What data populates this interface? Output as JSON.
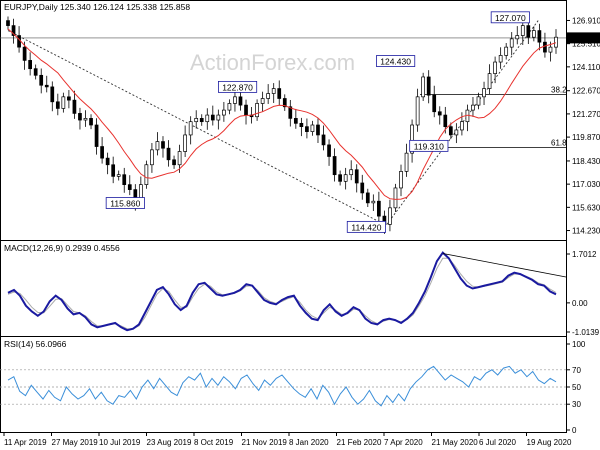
{
  "price_panel": {
    "header": "EURJPY,Daily  125.340 126.124 125.338 125.858",
    "watermark": "ActionForex.com",
    "y_ticks": [
      "126.910",
      "125.510",
      "124.110",
      "122.670",
      "121.270",
      "119.870",
      "118.430",
      "117.030",
      "115.630",
      "114.230"
    ],
    "current_price": "125.858",
    "price_labels": {
      "p127070": "127.070",
      "p124430": "124.430",
      "p122870": "122.870",
      "p115860": "115.860",
      "p119310": "119.310",
      "p114420": "114.420"
    },
    "fib_382": "38.2",
    "fib_618": "61.8"
  },
  "macd_panel": {
    "header": "MACD(12,26,9) 0.2939 0.4556",
    "y_ticks": [
      "1.7012",
      "0.00",
      "-1.0139"
    ]
  },
  "rsi_panel": {
    "header": "RSI(14) 56.0966",
    "y_ticks": [
      "100",
      "70",
      "50",
      "30",
      "0"
    ]
  },
  "x_axis": {
    "labels": [
      "11 Apr 2019",
      "27 May 2019",
      "10 Jul 2019",
      "23 Aug 2019",
      "8 Oct 2019",
      "21 Nov 2019",
      "8 Jan 2020",
      "21 Feb 2020",
      "7 Apr 2020",
      "21 May 2020",
      "6 Jul 2020",
      "19 Aug 2020"
    ]
  },
  "colors": {
    "candles": "#000000",
    "ma": "#e8322e",
    "macd": "#1a1aa0",
    "signal": "#aaaaaa",
    "rsi": "#3b8fd9",
    "label_box": "#1a1aa0",
    "current_price_bg": "#000000"
  },
  "chart_data": [
    {
      "type": "candlestick",
      "title": "EURJPY,Daily",
      "ohlc_last": {
        "open": 125.34,
        "high": 126.124,
        "low": 125.338,
        "close": 125.858
      },
      "ylim": [
        113.9,
        127.3
      ],
      "labeled_pivots": [
        {
          "label": "127.070",
          "value": 127.07
        },
        {
          "label": "124.430",
          "value": 124.43
        },
        {
          "label": "122.870",
          "value": 122.87
        },
        {
          "label": "119.310",
          "value": 119.31
        },
        {
          "label": "115.860",
          "value": 115.86
        },
        {
          "label": "114.420",
          "value": 114.42
        }
      ],
      "levels": [
        {
          "name": "38.2",
          "value": 122.45
        },
        {
          "name": "61.8",
          "value": 119.25
        }
      ],
      "closes": [
        126.6,
        126.0,
        125.3,
        124.5,
        124.0,
        123.6,
        123.0,
        122.9,
        122.0,
        121.6,
        122.3,
        122.1,
        121.3,
        120.9,
        121.0,
        120.6,
        119.3,
        118.6,
        118.2,
        117.5,
        117.6,
        117.0,
        116.7,
        116.0,
        117.0,
        118.2,
        119.1,
        119.6,
        119.2,
        118.5,
        118.2,
        119.0,
        120.0,
        120.8,
        121.0,
        120.8,
        121.2,
        120.9,
        121.2,
        121.5,
        121.9,
        122.3,
        121.8,
        121.2,
        121.1,
        121.9,
        122.2,
        122.5,
        122.8,
        122.2,
        121.7,
        121.0,
        120.7,
        120.5,
        120.2,
        120.6,
        120.0,
        119.4,
        118.7,
        117.6,
        117.2,
        117.6,
        117.9,
        117.1,
        116.5,
        115.9,
        116.0,
        115.1,
        114.6,
        115.6,
        116.8,
        117.8,
        118.9,
        120.6,
        122.3,
        123.5,
        122.4,
        121.4,
        121.2,
        120.5,
        120.0,
        120.3,
        120.8,
        121.5,
        121.8,
        122.3,
        122.8,
        123.7,
        124.4,
        124.8,
        125.3,
        125.8,
        126.0,
        126.6,
        125.9,
        126.3,
        125.6,
        125.0,
        125.3,
        125.9
      ]
    },
    {
      "type": "line",
      "title": "MACD(12,26,9)",
      "series": [
        {
          "name": "MACD",
          "value": 0.2939
        },
        {
          "name": "Signal",
          "value": 0.4556
        }
      ],
      "ylim": [
        -1.0139,
        1.7012
      ],
      "macd": [
        0.35,
        0.45,
        0.25,
        -0.1,
        -0.3,
        -0.45,
        -0.3,
        0.05,
        0.25,
        0.1,
        -0.2,
        -0.4,
        -0.35,
        -0.5,
        -0.75,
        -0.85,
        -0.8,
        -0.75,
        -0.7,
        -0.85,
        -0.95,
        -0.9,
        -0.75,
        -0.35,
        0.05,
        0.45,
        0.55,
        0.3,
        -0.05,
        -0.25,
        -0.1,
        0.35,
        0.65,
        0.7,
        0.5,
        0.3,
        0.25,
        0.3,
        0.35,
        0.45,
        0.65,
        0.6,
        0.35,
        0.1,
        0.0,
        -0.05,
        0.1,
        0.2,
        0.25,
        -0.1,
        -0.35,
        -0.55,
        -0.6,
        -0.25,
        -0.05,
        -0.3,
        -0.45,
        -0.35,
        -0.15,
        -0.25,
        -0.55,
        -0.7,
        -0.75,
        -0.6,
        -0.55,
        -0.6,
        -0.7,
        -0.55,
        -0.35,
        0.0,
        0.4,
        0.9,
        1.45,
        1.75,
        1.55,
        1.2,
        0.85,
        0.6,
        0.5,
        0.55,
        0.6,
        0.65,
        0.7,
        0.75,
        0.95,
        1.05,
        1.0,
        0.9,
        0.8,
        0.65,
        0.6,
        0.4,
        0.3
      ],
      "signal": [
        0.3,
        0.38,
        0.33,
        0.1,
        -0.15,
        -0.33,
        -0.35,
        -0.12,
        0.12,
        0.15,
        -0.08,
        -0.3,
        -0.35,
        -0.45,
        -0.65,
        -0.8,
        -0.8,
        -0.76,
        -0.72,
        -0.8,
        -0.9,
        -0.9,
        -0.8,
        -0.5,
        -0.1,
        0.3,
        0.5,
        0.4,
        0.1,
        -0.15,
        -0.15,
        0.2,
        0.5,
        0.65,
        0.58,
        0.38,
        0.28,
        0.28,
        0.33,
        0.42,
        0.58,
        0.6,
        0.42,
        0.18,
        0.05,
        -0.02,
        0.05,
        0.15,
        0.22,
        0.02,
        -0.25,
        -0.45,
        -0.55,
        -0.35,
        -0.15,
        -0.25,
        -0.4,
        -0.38,
        -0.22,
        -0.24,
        -0.45,
        -0.62,
        -0.72,
        -0.64,
        -0.58,
        -0.6,
        -0.66,
        -0.58,
        -0.42,
        -0.1,
        0.25,
        0.7,
        1.2,
        1.55,
        1.55,
        1.3,
        1.0,
        0.75,
        0.58,
        0.55,
        0.58,
        0.62,
        0.67,
        0.72,
        0.88,
        1.0,
        1.0,
        0.93,
        0.83,
        0.7,
        0.63,
        0.48,
        0.36
      ]
    },
    {
      "type": "line",
      "title": "RSI(14)",
      "series": [
        {
          "name": "RSI",
          "value": 56.0966
        }
      ],
      "ylim": [
        0,
        100
      ],
      "levels": [
        70,
        50,
        30
      ],
      "rsi": [
        58,
        62,
        45,
        40,
        52,
        44,
        36,
        46,
        38,
        34,
        50,
        42,
        36,
        40,
        48,
        36,
        44,
        34,
        30,
        40,
        38,
        46,
        36,
        50,
        58,
        48,
        60,
        52,
        44,
        40,
        55,
        62,
        58,
        66,
        50,
        60,
        52,
        62,
        56,
        48,
        60,
        64,
        54,
        46,
        58,
        52,
        60,
        64,
        56,
        48,
        42,
        38,
        48,
        36,
        52,
        44,
        30,
        42,
        50,
        38,
        30,
        36,
        46,
        34,
        28,
        40,
        32,
        42,
        34,
        48,
        56,
        62,
        70,
        74,
        66,
        58,
        64,
        60,
        56,
        50,
        62,
        58,
        66,
        70,
        64,
        72,
        74,
        66,
        70,
        62,
        68,
        58,
        54,
        60,
        56
      ]
    }
  ]
}
